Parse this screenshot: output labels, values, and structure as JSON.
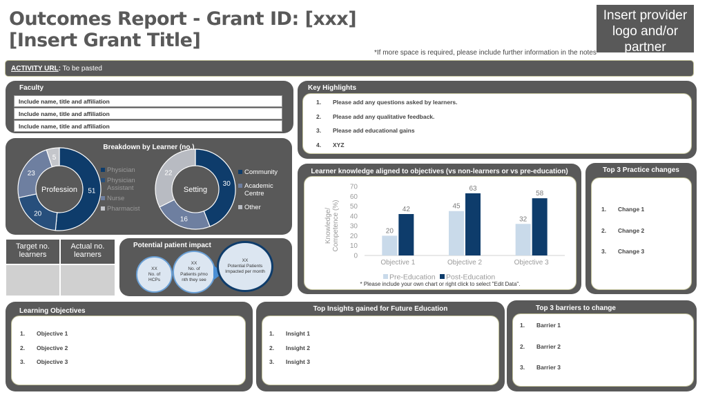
{
  "header": {
    "title_line1": "Outcomes Report - Grant ID: [xxx]",
    "title_line2": "[Insert Grant Title]",
    "logo_placeholder": "Insert provider logo and/or partner",
    "space_note": "*If more space is required, please include further information in the notes"
  },
  "activity": {
    "label": "ACTIVITY URL",
    "value": "To be pasted"
  },
  "faculty": {
    "title": "Faculty",
    "rows": [
      "Include name, title and affiliation",
      "Include name, title and affiliation",
      "Include name, title and affiliation"
    ]
  },
  "highlights": {
    "title": "Key Highlights",
    "items": [
      {
        "num": "1.",
        "text": "Please add any questions asked by learners."
      },
      {
        "num": "2.",
        "text": "Please add any qualitative feedback."
      },
      {
        "num": "3.",
        "text": "Please add educational gains"
      },
      {
        "num": "4.",
        "text": "XYZ"
      }
    ]
  },
  "breakdown": {
    "title": "Breakdown by Learner (no.)",
    "profession_label": "Profession",
    "setting_label": "Setting"
  },
  "practice_changes": {
    "title": "Top 3 Practice changes",
    "items": [
      {
        "num": "1.",
        "text": "Change 1"
      },
      {
        "num": "2.",
        "text": "Change 2"
      },
      {
        "num": "3.",
        "text": "Change 3"
      }
    ]
  },
  "knowledge": {
    "title": "Learner knowledge aligned to objectives (vs non-learners or vs pre-education)",
    "chart_note": "* Please include your own chart or right click to select \"Edit Data\"."
  },
  "learners_table": {
    "target": "Target no. learners",
    "actual": "Actual no. learners"
  },
  "patient_impact": {
    "title": "Potential patient impact",
    "bubble1_value": "XX",
    "bubble1_label": "No. of HCPs",
    "bubble2_value": "XX",
    "bubble2_label": "No. of Patients p/mo nth they see",
    "bubble3_value": "XX",
    "bubble3_label": "Potential Patients Impacted per month"
  },
  "objectives": {
    "title": "Learning Objectives",
    "items": [
      {
        "num": "1.",
        "text": "Objective 1"
      },
      {
        "num": "2.",
        "text": "Objective 2"
      },
      {
        "num": "3.",
        "text": "Objective 3"
      }
    ]
  },
  "insights": {
    "title": "Top Insights gained for Future Education",
    "items": [
      {
        "num": "1.",
        "text": "Insight 1"
      },
      {
        "num": "2.",
        "text": "Insight 2"
      },
      {
        "num": "3.",
        "text": "Insight 3"
      }
    ]
  },
  "barriers": {
    "title": "Top 3 barriers to change",
    "items": [
      {
        "num": "1.",
        "text": "Barrier 1"
      },
      {
        "num": "2.",
        "text": "Barrier 2"
      },
      {
        "num": "3.",
        "text": "Barrier 3"
      }
    ]
  },
  "chart_data": [
    {
      "type": "pie",
      "title": "",
      "center_label": "Profession",
      "categories": [
        "Physician",
        "Physician Assistant",
        "Nurse",
        "Pharmacist"
      ],
      "values": [
        51,
        20,
        23,
        5
      ],
      "colors": [
        "#0e3c6b",
        "#274f7c",
        "#6e7fa0",
        "#c4c6cb"
      ]
    },
    {
      "type": "pie",
      "title": "",
      "center_label": "Setting",
      "categories": [
        "Community",
        "Academic Centre",
        "Other"
      ],
      "values": [
        30,
        16,
        22
      ],
      "colors": [
        "#0e3c6b",
        "#6e7fa0",
        "#b8bbc2"
      ]
    },
    {
      "type": "bar",
      "title": "",
      "categories": [
        "Objective 1",
        "Objective 2",
        "Objective 3"
      ],
      "series": [
        {
          "name": "Pre-Education",
          "values": [
            20,
            45,
            32
          ],
          "color": "#c9daea"
        },
        {
          "name": "Post-Education",
          "values": [
            42,
            63,
            58
          ],
          "color": "#0e3c6b"
        }
      ],
      "ylabel": "Knowledge/ Competence (%)",
      "ylim": [
        0,
        70
      ],
      "yticks": [
        0,
        10,
        20,
        30,
        40,
        50,
        60,
        70
      ],
      "grid": false,
      "legend": "bottom"
    }
  ]
}
